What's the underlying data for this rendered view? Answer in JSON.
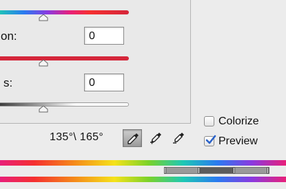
{
  "sliders": [
    {
      "name": "hue",
      "value_percent": 31
    },
    {
      "name": "saturation",
      "value_percent": 31
    },
    {
      "name": "lightness",
      "value_percent": 31
    }
  ],
  "fields": {
    "saturation": {
      "label": "on:",
      "value": "0"
    },
    "lightness": {
      "label": "s:",
      "value": "0"
    }
  },
  "range": {
    "text": "135°\\ 165°"
  },
  "tools": [
    {
      "name": "eyedropper-icon",
      "active": true
    },
    {
      "name": "eyedropper-plus-icon",
      "active": false
    },
    {
      "name": "eyedropper-minus-icon",
      "active": false
    }
  ],
  "checks": {
    "colorize": {
      "label": "Colorize",
      "checked": false
    },
    "preview": {
      "label": "Preview",
      "checked": true
    }
  },
  "colors": {
    "accent": "#2a62c9",
    "saturation_track": "#d5263a",
    "lightness_track": "#ffffff"
  }
}
